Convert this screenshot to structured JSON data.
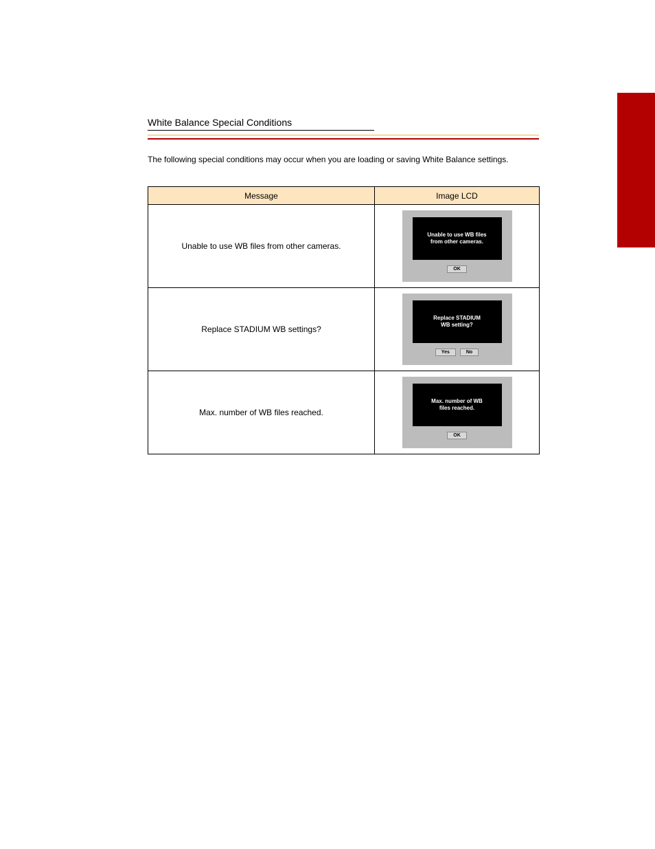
{
  "page": {
    "section_title": "White Balance Special Conditions",
    "intro": "The following special conditions may occur when you are loading or saving White Balance settings.",
    "table": {
      "headers": [
        "Message",
        "Image LCD"
      ],
      "rows": [
        {
          "msg": "Unable to use WB files from other cameras.",
          "lcd_text_line1": "Unable to use WB files",
          "lcd_text_line2": "from other cameras.",
          "buttons": [
            "OK"
          ]
        },
        {
          "msg": "Replace STADIUM WB settings?",
          "lcd_text_line1": "Replace STADIUM",
          "lcd_text_line2": "WB setting?",
          "buttons": [
            "Yes",
            "No"
          ]
        },
        {
          "msg": "Max. number of WB files reached.",
          "lcd_text_line1": "Max. number of WB",
          "lcd_text_line2": "files reached.",
          "buttons": [
            "OK"
          ]
        }
      ]
    }
  }
}
